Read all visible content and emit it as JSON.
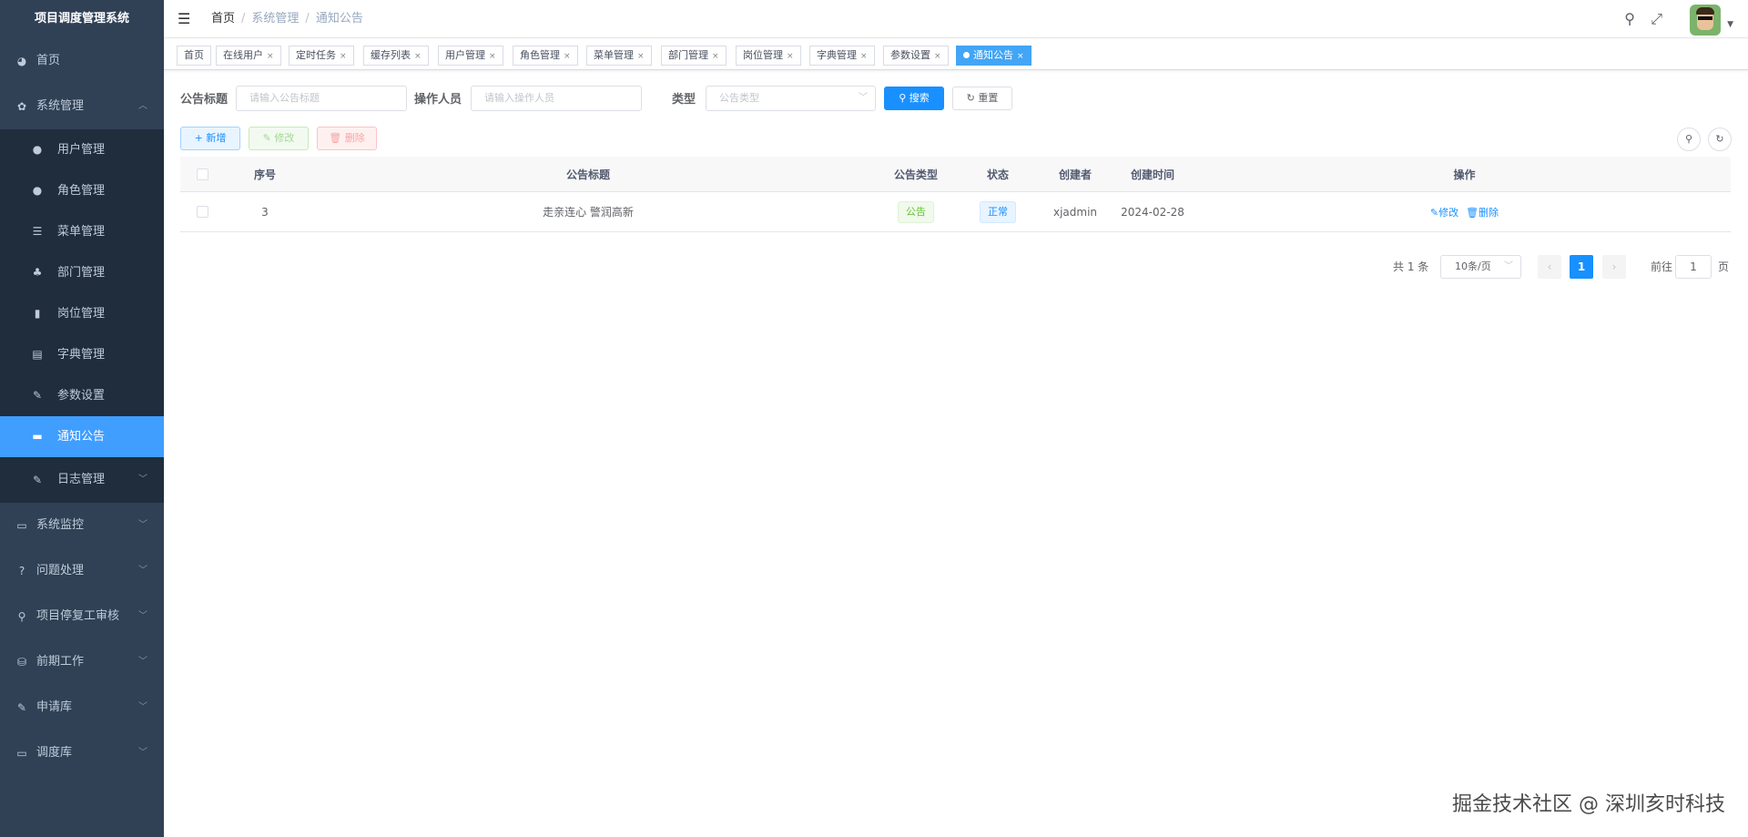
{
  "app": {
    "title": "项目调度管理系统"
  },
  "sidebar": {
    "items": [
      {
        "label": "首页",
        "icon": "dashboard-icon"
      },
      {
        "label": "系统管理",
        "icon": "gear-icon"
      },
      {
        "label": "系统监控",
        "icon": "monitor-icon"
      },
      {
        "label": "问题处理",
        "icon": "question-icon"
      },
      {
        "label": "项目停复工审核",
        "icon": "audit-icon"
      },
      {
        "label": "前期工作",
        "icon": "flow-icon"
      },
      {
        "label": "申请库",
        "icon": "edit-icon"
      },
      {
        "label": "调度库",
        "icon": "monitor-icon"
      }
    ],
    "submenu": [
      {
        "label": "用户管理",
        "icon": "user-icon"
      },
      {
        "label": "角色管理",
        "icon": "peoples-icon"
      },
      {
        "label": "菜单管理",
        "icon": "tree-table-icon"
      },
      {
        "label": "部门管理",
        "icon": "tree-icon"
      },
      {
        "label": "岗位管理",
        "icon": "post-icon"
      },
      {
        "label": "字典管理",
        "icon": "dict-icon"
      },
      {
        "label": "参数设置",
        "icon": "edit-icon"
      },
      {
        "label": "通知公告",
        "icon": "message-icon"
      },
      {
        "label": "日志管理",
        "icon": "log-icon"
      }
    ]
  },
  "breadcrumb": [
    "首页",
    "系统管理",
    "通知公告"
  ],
  "tags": [
    "首页",
    "在线用户",
    "定时任务",
    "缓存列表",
    "用户管理",
    "角色管理",
    "菜单管理",
    "部门管理",
    "岗位管理",
    "字典管理",
    "参数设置",
    "通知公告"
  ],
  "search": {
    "title_label": "公告标题",
    "title_placeholder": "请输入公告标题",
    "operator_label": "操作人员",
    "operator_placeholder": "请输入操作人员",
    "type_label": "类型",
    "type_placeholder": "公告类型",
    "search_btn": "搜索",
    "reset_btn": "重置"
  },
  "toolbar": {
    "add": "新增",
    "edit": "修改",
    "delete": "删除"
  },
  "table": {
    "columns": [
      "序号",
      "公告标题",
      "公告类型",
      "状态",
      "创建者",
      "创建时间",
      "操作"
    ],
    "rows": [
      {
        "id": "3",
        "title": "走亲连心 警润高新",
        "type": "公告",
        "status": "正常",
        "creator": "xjadmin",
        "created": "2024-02-28",
        "edit": "修改",
        "delete": "删除"
      }
    ]
  },
  "pagination": {
    "total": "共 1 条",
    "page_size": "10条/页",
    "current": "1",
    "goto_label": "前往",
    "goto_value": "1",
    "page_unit": "页"
  },
  "watermark": "掘金技术社区 @ 深圳亥时科技",
  "colors": {
    "sidebar_bg": "#304156",
    "submenu_bg": "#1f2d3d",
    "active": "#409eff",
    "primary": "#1890ff"
  }
}
